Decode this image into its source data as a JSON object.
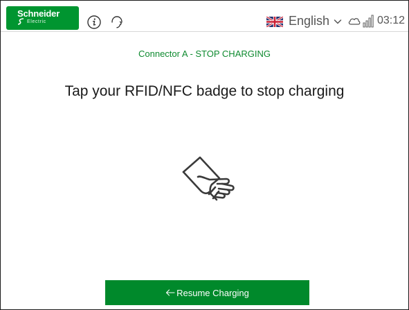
{
  "header": {
    "brand": {
      "name": "Schneider",
      "sub": "Electric",
      "color": "#009530"
    },
    "info_icon": "info-icon",
    "support_icon": "headset-icon",
    "language": {
      "flag_icon": "uk-flag-icon",
      "label": "English",
      "dropdown_icon": "chevron-down-icon"
    },
    "cloud_icon": "cloud-icon",
    "signal_icon": "signal-bars-icon",
    "time": "03:12"
  },
  "main": {
    "subtitle": "Connector A - STOP CHARGING",
    "instruction": "Tap your RFID/NFC badge to stop charging",
    "illustration_icon": "hand-badge-icon"
  },
  "footer": {
    "resume_button_label": "Resume Charging",
    "resume_button_icon": "arrow-left-icon",
    "accent_color": "#00892b"
  }
}
